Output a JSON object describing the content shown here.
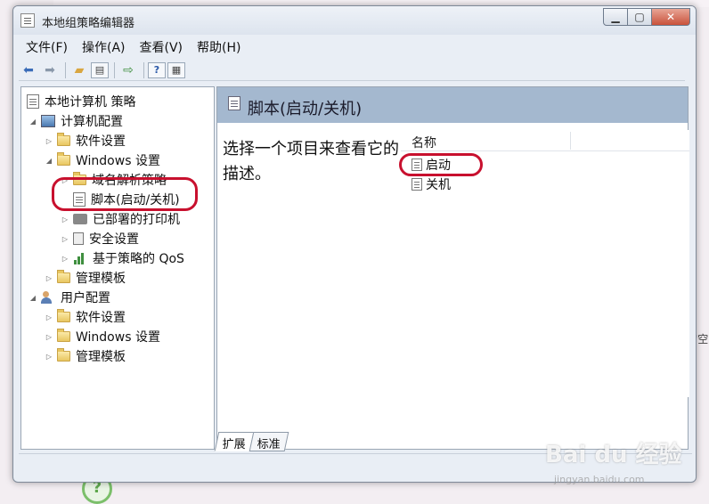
{
  "window": {
    "title": "本地组策略编辑器",
    "minimize": "▁",
    "maximize": "▢",
    "close": "✕"
  },
  "menu": [
    "文件(F)",
    "操作(A)",
    "查看(V)",
    "帮助(H)"
  ],
  "toolbar": {
    "icons": [
      "back-arrow-icon",
      "forward-arrow-icon",
      "up-folder-icon",
      "show-hide-tree-icon",
      "export-list-icon",
      "help-icon",
      "properties-icon"
    ],
    "help_label": "?"
  },
  "tree": {
    "root": "本地计算机 策略",
    "computer_config": "计算机配置",
    "software_settings_1": "软件设置",
    "windows_settings_1": "Windows 设置",
    "name_resolution_policy": "域名解析策略",
    "scripts": "脚本(启动/关机)",
    "deployed_printers": "已部署的打印机",
    "security_settings": "安全设置",
    "qos_policy": "基于策略的 QoS",
    "admin_templates_1": "管理模板",
    "user_config": "用户配置",
    "software_settings_2": "软件设置",
    "windows_settings_2": "Windows 设置",
    "admin_templates_2": "管理模板"
  },
  "details": {
    "header_title": "脚本(启动/关机)",
    "description": "选择一个项目来查看它的描述。",
    "column_name": "名称",
    "items": [
      "启动",
      "关机"
    ]
  },
  "tabs": [
    "扩展",
    "标准"
  ],
  "background": {
    "watermark": "Bai du 经验",
    "watermark_sub": "jingyan.baidu.com",
    "right_fragment": "'空",
    "help_glyph": "?"
  },
  "annotation_color": "#c8102e"
}
